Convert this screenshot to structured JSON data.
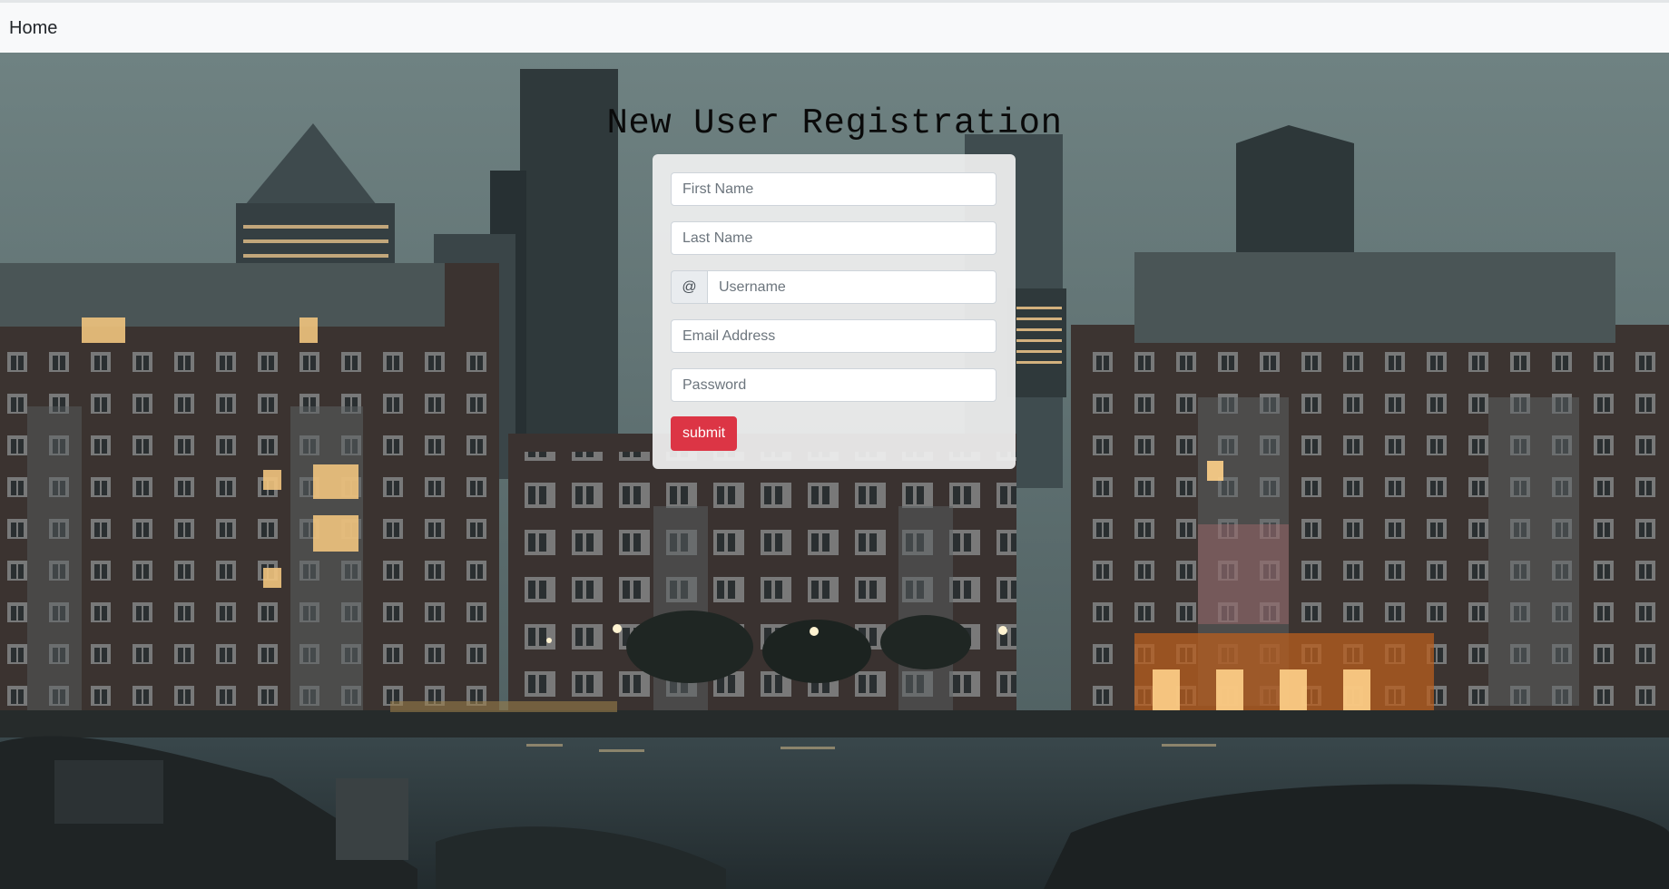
{
  "nav": {
    "home_label": "Home"
  },
  "page": {
    "title": "New User Registration"
  },
  "form": {
    "first_name": {
      "placeholder": "First Name",
      "value": ""
    },
    "last_name": {
      "placeholder": "Last Name",
      "value": ""
    },
    "username": {
      "prefix": "@",
      "placeholder": "Username",
      "value": ""
    },
    "email": {
      "placeholder": "Email Address",
      "value": ""
    },
    "password": {
      "placeholder": "Password",
      "value": ""
    },
    "submit_label": "submit"
  },
  "colors": {
    "navbar_bg": "#f8f9fa",
    "submit_bg": "#dc3545",
    "card_bg": "#f0f0f0"
  },
  "background": {
    "description_icon": "city-night-riverside-photo"
  }
}
